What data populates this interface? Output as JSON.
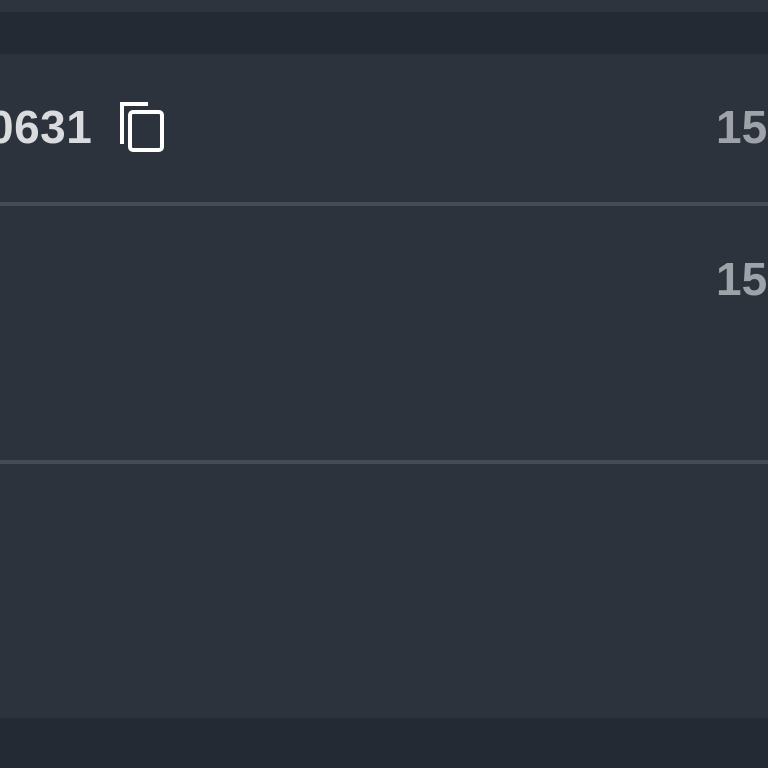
{
  "rows": [
    {
      "id_text": "0631",
      "right_value": "15"
    },
    {
      "id_text": "",
      "right_value": "15"
    },
    {
      "id_text": "",
      "right_value": ""
    }
  ],
  "icons": {
    "copy": "copy-icon"
  },
  "colors": {
    "background": "#2d333c",
    "header": "#242a33",
    "divider": "#454b54",
    "primary_text": "#d9dbde",
    "secondary_text": "#9ea3a9"
  }
}
